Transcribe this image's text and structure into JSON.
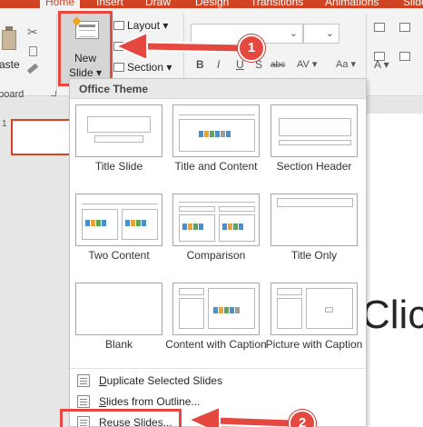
{
  "ribbon": {
    "tabs": [
      {
        "label": "Home",
        "active": true
      },
      {
        "label": "Insert"
      },
      {
        "label": "Draw"
      },
      {
        "label": "Design"
      },
      {
        "label": "Transitions"
      },
      {
        "label": "Animations"
      },
      {
        "label": "Slide"
      }
    ],
    "paste_label": "aste",
    "clipboard_label": "pboard",
    "new_slide_line1": "New",
    "new_slide_line2": "Slide ▾",
    "layout_label": "Layout ▾",
    "reset_label": "R",
    "section_label": "Section ▾",
    "format_row": [
      "B",
      "I",
      "U",
      "S",
      "abc",
      "AV ▾",
      "Aa ▾",
      "A ▾"
    ]
  },
  "dropdown": {
    "header": "Office Theme",
    "layouts": [
      {
        "name": "Title Slide"
      },
      {
        "name": "Title and Content"
      },
      {
        "name": "Section Header"
      },
      {
        "name": "Two Content"
      },
      {
        "name": "Comparison"
      },
      {
        "name": "Title Only"
      },
      {
        "name": "Blank"
      },
      {
        "name": "Content with Caption"
      },
      {
        "name": "Picture with Caption"
      }
    ],
    "menu": [
      {
        "label": "Duplicate Selected Slides",
        "accel": "D",
        "rest": "uplicate Selected Slides"
      },
      {
        "label": "Slides from Outline...",
        "accel": "S",
        "rest": "lides from Outline..."
      },
      {
        "label": "Reuse Slides...",
        "accel": "R",
        "rest": "euse Slides..."
      }
    ]
  },
  "annotations": {
    "badge1": "1",
    "badge2": "2"
  },
  "slide": {
    "thumb_number": "1",
    "title_fragment": "Clic"
  },
  "colors": {
    "accent": "#d04423",
    "callout": "#e5483f"
  }
}
